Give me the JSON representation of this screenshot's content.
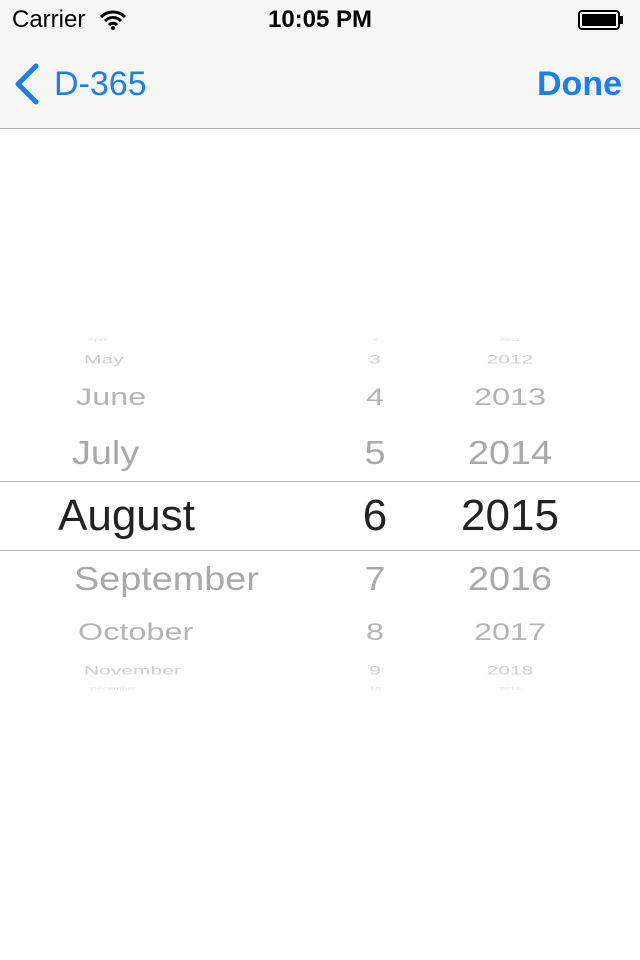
{
  "status_bar": {
    "carrier": "Carrier",
    "time": "10:05 PM"
  },
  "nav": {
    "back_label": "D-365",
    "done_label": "Done",
    "accent_color": "#1a7ff5"
  },
  "picker": {
    "months": [
      "April",
      "May",
      "June",
      "July",
      "August",
      "September",
      "October",
      "November",
      "December"
    ],
    "days": [
      "2",
      "3",
      "4",
      "5",
      "6",
      "7",
      "8",
      "9",
      "10"
    ],
    "years": [
      "2011",
      "2012",
      "2013",
      "2014",
      "2015",
      "2016",
      "2017",
      "2018",
      "2019"
    ],
    "selected": {
      "month": "August",
      "day": "6",
      "year": "2015"
    }
  }
}
